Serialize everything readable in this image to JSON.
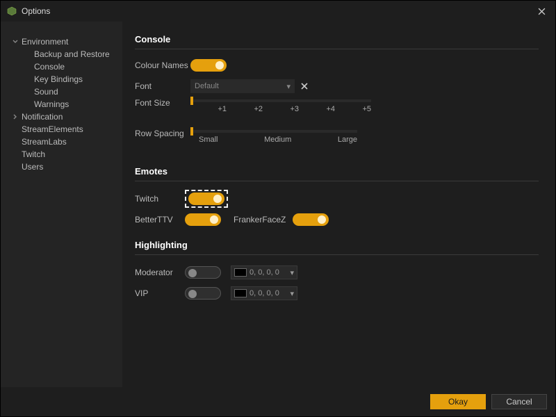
{
  "window": {
    "title": "Options"
  },
  "sidebar": {
    "items": [
      {
        "label": "Environment",
        "expanded": true
      },
      {
        "label": "Backup and Restore"
      },
      {
        "label": "Console"
      },
      {
        "label": "Key Bindings"
      },
      {
        "label": "Sound"
      },
      {
        "label": "Warnings"
      },
      {
        "label": "Notification",
        "expanded": false
      },
      {
        "label": "StreamElements"
      },
      {
        "label": "StreamLabs"
      },
      {
        "label": "Twitch"
      },
      {
        "label": "Users"
      }
    ]
  },
  "sections": {
    "console": {
      "title": "Console",
      "colour_names_label": "Colour Names",
      "colour_names_on": true,
      "font_label": "Font",
      "font_value": "Default",
      "font_size_label": "Font Size",
      "font_size_ticks": [
        "",
        "+1",
        "+2",
        "+3",
        "+4",
        "+5"
      ],
      "row_spacing_label": "Row Spacing",
      "row_spacing_ticks": [
        "Small",
        "Medium",
        "Large"
      ]
    },
    "emotes": {
      "title": "Emotes",
      "twitch_label": "Twitch",
      "twitch_on": true,
      "bttv_label": "BetterTTV",
      "bttv_on": true,
      "ffz_label": "FrankerFaceZ",
      "ffz_on": true
    },
    "highlighting": {
      "title": "Highlighting",
      "moderator_label": "Moderator",
      "moderator_on": false,
      "moderator_color": "0, 0, 0, 0",
      "vip_label": "VIP",
      "vip_on": false,
      "vip_color": "0, 0, 0, 0"
    }
  },
  "footer": {
    "ok": "Okay",
    "cancel": "Cancel"
  }
}
